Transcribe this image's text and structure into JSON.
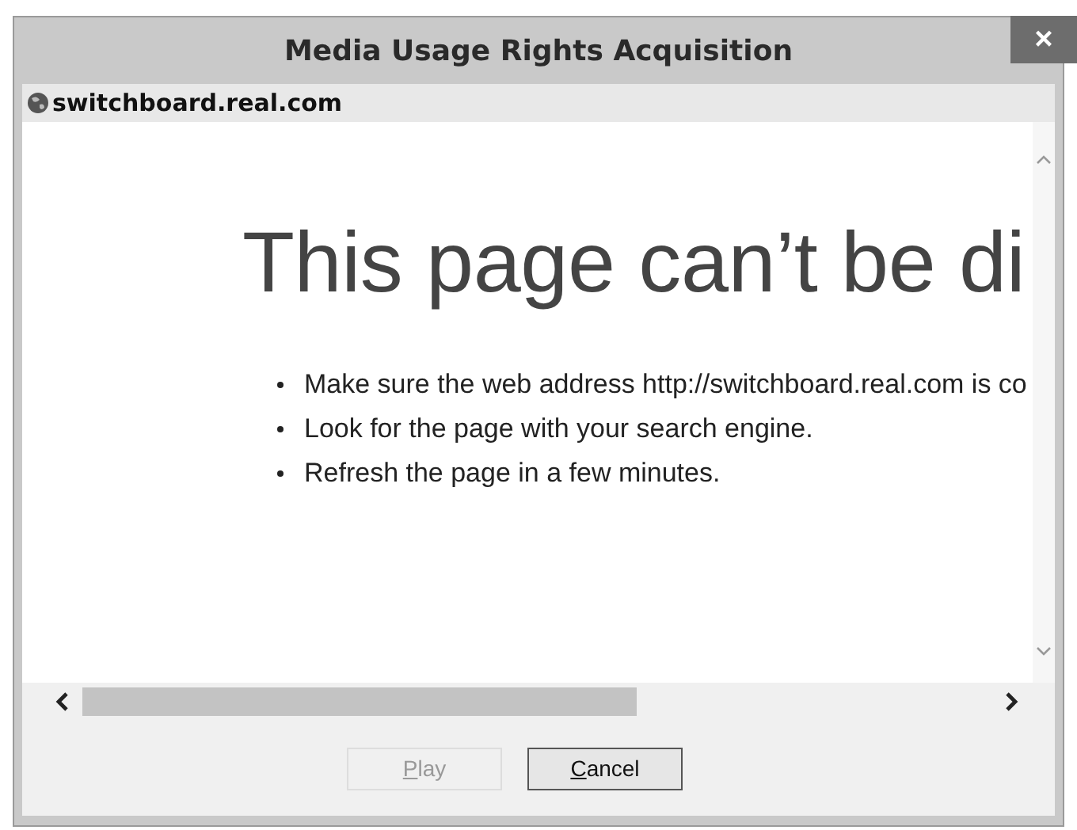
{
  "window": {
    "title": "Media Usage Rights Acquisition",
    "close": "×"
  },
  "address_bar": {
    "host": "switchboard.real.com"
  },
  "page": {
    "heading": "This page can’t be di",
    "tips": [
      "Make sure the web address http://switchboard.real.com is co",
      "Look for the page with your search engine.",
      "Refresh the page in a few minutes."
    ]
  },
  "buttons": [
    {
      "label": "Play",
      "disabled": true
    },
    {
      "label": "Cancel",
      "disabled": false
    }
  ]
}
